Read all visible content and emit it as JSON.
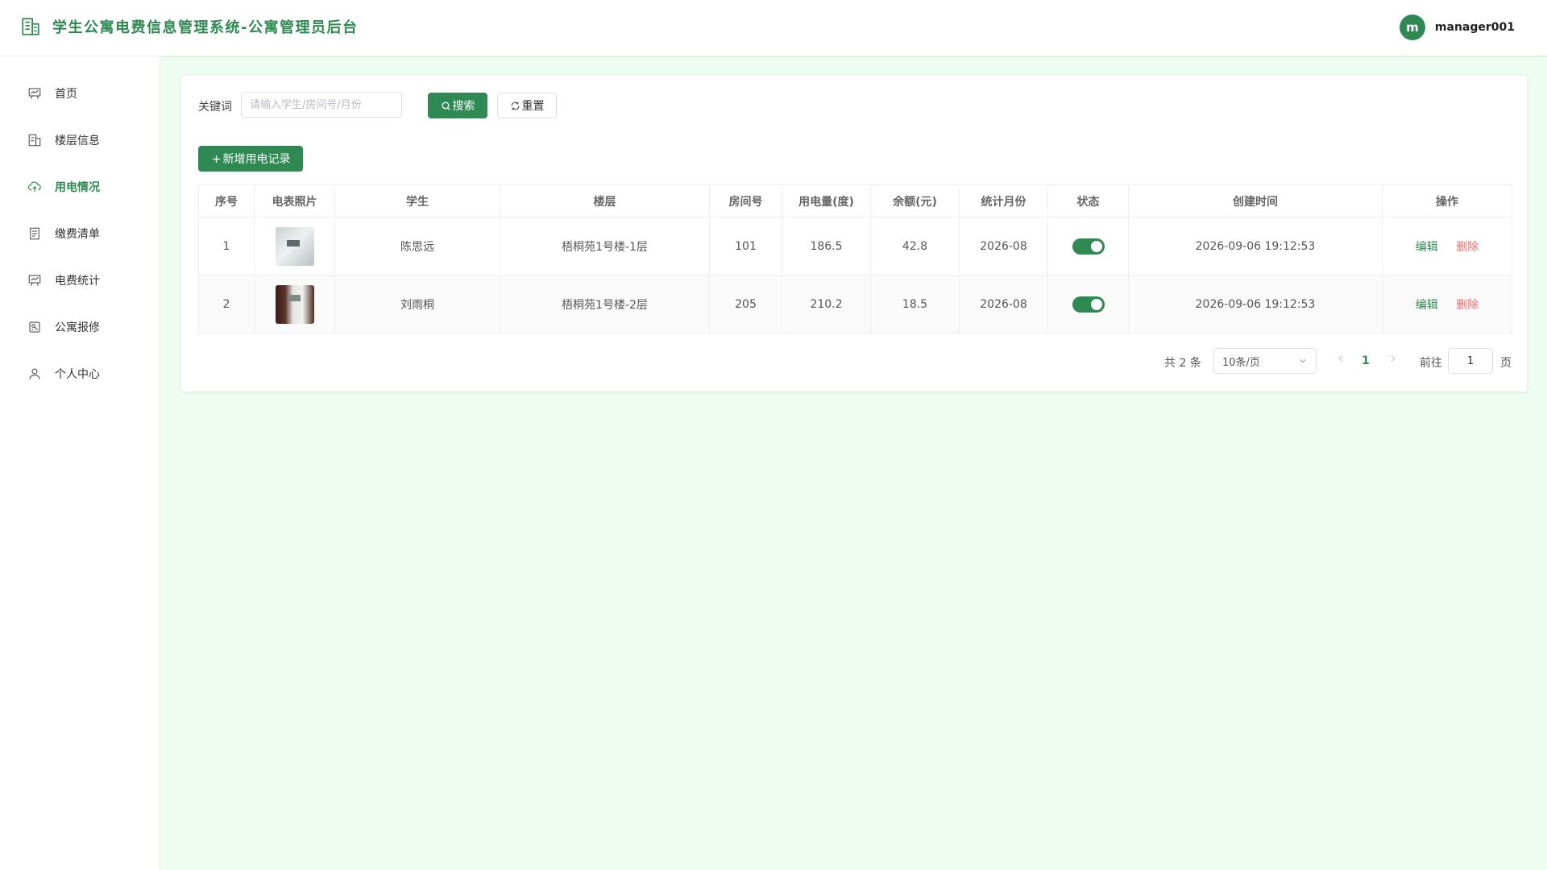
{
  "app": {
    "title": "学生公寓电费信息管理系统-公寓管理员后台",
    "user": {
      "avatar_letter": "m",
      "name": "manager001"
    }
  },
  "sidebar": {
    "items": [
      {
        "label": "首页",
        "icon": "dashboard-icon",
        "active": false
      },
      {
        "label": "楼层信息",
        "icon": "building-icon",
        "active": false
      },
      {
        "label": "用电情况",
        "icon": "cloud-upload-icon",
        "active": true
      },
      {
        "label": "缴费清单",
        "icon": "document-icon",
        "active": false
      },
      {
        "label": "电费统计",
        "icon": "chart-board-icon",
        "active": false
      },
      {
        "label": "公寓报修",
        "icon": "repair-icon",
        "active": false
      },
      {
        "label": "个人中心",
        "icon": "user-icon",
        "active": false
      }
    ]
  },
  "search": {
    "label": "关键词",
    "value": "",
    "placeholder": "请输入学生/房间号/月份",
    "search_button": "搜索",
    "reset_button": "重置"
  },
  "actions": {
    "add_button": "新增用电记录"
  },
  "table": {
    "columns": [
      "序号",
      "电表照片",
      "学生",
      "楼层",
      "房间号",
      "用电量(度)",
      "余额(元)",
      "统计月份",
      "状态",
      "创建时间",
      "操作"
    ],
    "rows": [
      {
        "index": "1",
        "student": "陈思远",
        "floor": "梧桐苑1号楼-1层",
        "room": "101",
        "usage": "186.5",
        "balance": "42.8",
        "month": "2026-08",
        "status_on": true,
        "created": "2026-09-06 19:12:53",
        "edit": "编辑",
        "delete": "删除"
      },
      {
        "index": "2",
        "student": "刘雨桐",
        "floor": "梧桐苑1号楼-2层",
        "room": "205",
        "usage": "210.2",
        "balance": "18.5",
        "month": "2026-08",
        "status_on": true,
        "created": "2026-09-06 19:12:53",
        "edit": "编辑",
        "delete": "删除"
      }
    ]
  },
  "pagination": {
    "total_text": "共 2 条",
    "page_size": "10条/页",
    "current_page": "1",
    "goto_label": "前往",
    "goto_value": "1",
    "page_suffix": "页"
  },
  "colors": {
    "primary": "#2e8a52",
    "danger": "#f56c6c",
    "background": "#eefcf2"
  }
}
